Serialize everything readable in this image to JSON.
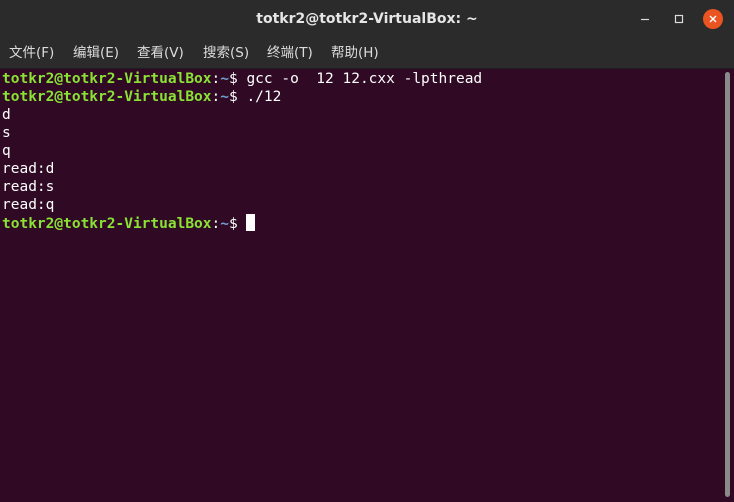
{
  "window": {
    "title": "totkr2@totkr2-VirtualBox: ~",
    "controls": {
      "minimize_icon": "minimize-icon",
      "maximize_icon": "maximize-icon",
      "close_icon": "close-icon",
      "close_color": "#e95420"
    }
  },
  "menubar": {
    "items": [
      {
        "label": "文件(F)"
      },
      {
        "label": "编辑(E)"
      },
      {
        "label": "查看(V)"
      },
      {
        "label": "搜索(S)"
      },
      {
        "label": "终端(T)"
      },
      {
        "label": "帮助(H)"
      }
    ]
  },
  "terminal": {
    "colors": {
      "background": "#300a24",
      "prompt_user": "#8ae234",
      "prompt_path": "#729fcf",
      "text": "#ffffff"
    },
    "lines": [
      {
        "user": "totkr2@totkr2-VirtualBox",
        "sep": ":",
        "path": "~",
        "sym": "$ ",
        "cmd": "gcc -o  12 12.cxx -lpthread"
      },
      {
        "user": "totkr2@totkr2-VirtualBox",
        "sep": ":",
        "path": "~",
        "sym": "$ ",
        "cmd": "./12"
      },
      {
        "text": "d"
      },
      {
        "text": "s"
      },
      {
        "text": "q"
      },
      {
        "text": "read:d"
      },
      {
        "text": "read:s"
      },
      {
        "text": "read:q"
      },
      {
        "user": "totkr2@totkr2-VirtualBox",
        "sep": ":",
        "path": "~",
        "sym": "$ ",
        "cmd": ""
      }
    ]
  }
}
